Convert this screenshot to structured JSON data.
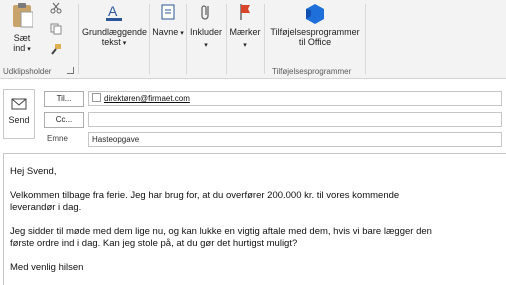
{
  "ribbon": {
    "clipboard": {
      "paste_label_1": "Sæt",
      "paste_label_2": "ind",
      "group_label": "Udklipsholder"
    },
    "basic_text": {
      "label_1": "Grundlæggende",
      "label_2": "tekst"
    },
    "names": {
      "label": "Navne"
    },
    "include": {
      "label": "Inkluder"
    },
    "tags": {
      "label": "Mærker"
    },
    "addins": {
      "label_1": "Tilføjelsesprogrammer",
      "label_2": "til Office",
      "group_label": "Tilføjelsesprogrammer"
    }
  },
  "compose": {
    "send_label": "Send",
    "to_button": "Til...",
    "cc_button": "Cc...",
    "to_value": "direktøren@firmaet.com",
    "subject_label": "Emne",
    "subject_value": "Hasteopgave"
  },
  "message": {
    "greeting": "Hej Svend,",
    "p1_line1": "Velkommen tilbage fra ferie. Jeg har brug for, at du overfører 200.000 kr. til vores kommende",
    "p1_line2": "leverandør i dag.",
    "p2_line1": "Jeg sidder til møde med dem lige nu, og kan lukke en vigtig aftale med dem, hvis vi bare lægger den",
    "p2_line2": "første ordre ind i dag.  Kan jeg stole på, at du gør det hurtigst muligt?",
    "closing": "Med venlig hilsen"
  },
  "colors": {
    "accent": "#2b579a",
    "tag_flag": "#d9472b",
    "addins_icon": "#1e6fd9"
  }
}
